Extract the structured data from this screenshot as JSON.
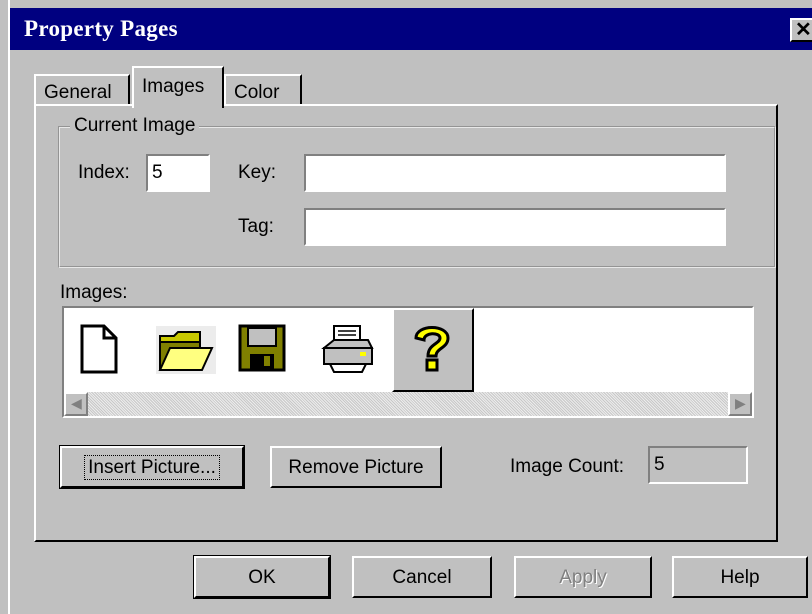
{
  "window": {
    "title": "Property Pages",
    "close_label": "x"
  },
  "tabs": [
    {
      "label": "General"
    },
    {
      "label": "Images",
      "active": true
    },
    {
      "label": "Color"
    }
  ],
  "current_image": {
    "group_label": "Current Image",
    "index_label": "Index:",
    "index_value": "5",
    "key_label": "Key:",
    "key_value": "",
    "tag_label": "Tag:",
    "tag_value": ""
  },
  "images": {
    "label": "Images:",
    "items": [
      {
        "icon": "new-document-icon"
      },
      {
        "icon": "open-folder-icon"
      },
      {
        "icon": "floppy-disk-icon"
      },
      {
        "icon": "printer-icon"
      },
      {
        "icon": "help-question-icon",
        "selected": true
      }
    ]
  },
  "actions": {
    "insert_picture": "Insert Picture...",
    "remove_picture": "Remove Picture",
    "image_count_label": "Image Count:",
    "image_count_value": "5"
  },
  "footer": {
    "ok": "OK",
    "cancel": "Cancel",
    "apply": "Apply",
    "help": "Help"
  },
  "colors": {
    "titlebar": "#000080",
    "face": "#c0c0c0"
  }
}
